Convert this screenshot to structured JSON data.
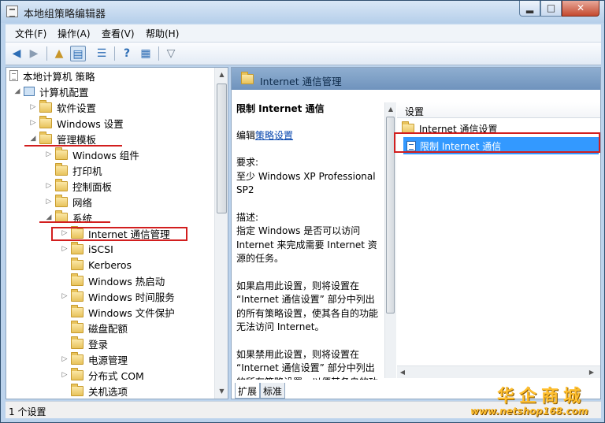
{
  "window": {
    "title": "本地组策略编辑器",
    "min_glyph": "▂",
    "max_glyph": "□",
    "close_glyph": "✕"
  },
  "menu": [
    "文件(F)",
    "操作(A)",
    "查看(V)",
    "帮助(H)"
  ],
  "toolbar": [
    "back-icon",
    "forward-icon",
    "up-folder-icon",
    "show-hide-tree-icon",
    "export-list-icon",
    "help-icon",
    "properties-icon",
    "filter-icon"
  ],
  "tree": {
    "root": "本地计算机 策略",
    "computer_config": "计算机配置",
    "software_settings": "软件设置",
    "windows_settings": "Windows 设置",
    "admin_templates": "管理模板",
    "windows_components": "Windows 组件",
    "printers": "打印机",
    "control_panel": "控制面板",
    "network": "网络",
    "system": "系统",
    "internet_comm_mgmt": "Internet 通信管理",
    "iscsi": "iSCSI",
    "kerberos": "Kerberos",
    "windows_hot_start": "Windows 热启动",
    "windows_time_service": "Windows 时间服务",
    "windows_file_protection": "Windows 文件保护",
    "disk_quotas": "磁盘配额",
    "logon": "登录",
    "power_management": "电源管理",
    "distributed_com": "分布式 COM",
    "shutdown_options": "关机选项"
  },
  "right": {
    "header": "Internet 通信管理",
    "desc_title": "限制 Internet 通信",
    "edit_prefix": "编辑",
    "edit_link": "策略设置",
    "requirements_label": "要求:",
    "requirements": "至少 Windows XP Professional SP2",
    "description_label": "描述:",
    "description_1": "指定 Windows 是否可以访问 Internet 来完成需要 Internet 资源的任务。",
    "description_2": "如果启用此设置，则将设置在 “Internet 通信设置” 部分中列出的所有策略设置，使其各自的功能无法访问 Internet。",
    "description_3": "如果禁用此设置，则将设置在 “Internet 通信设置” 部分中列出的所有策略设置，以便其各自的功",
    "column_header": "设置",
    "rows": [
      {
        "label": "Internet 通信设置",
        "icon": "folder-icon"
      },
      {
        "label": "限制 Internet 通信",
        "icon": "policy-icon",
        "selected": true
      }
    ],
    "tabs": [
      "扩展",
      "标准"
    ]
  },
  "status": "1 个设置",
  "watermark": {
    "brand": "华企商城",
    "url": "www.netshop168.com"
  },
  "colors": {
    "highlight": "#3399ff",
    "annotation_red": "#d21e1e",
    "header_blue": "#7fa2c9",
    "watermark": "#ffbf2e"
  }
}
